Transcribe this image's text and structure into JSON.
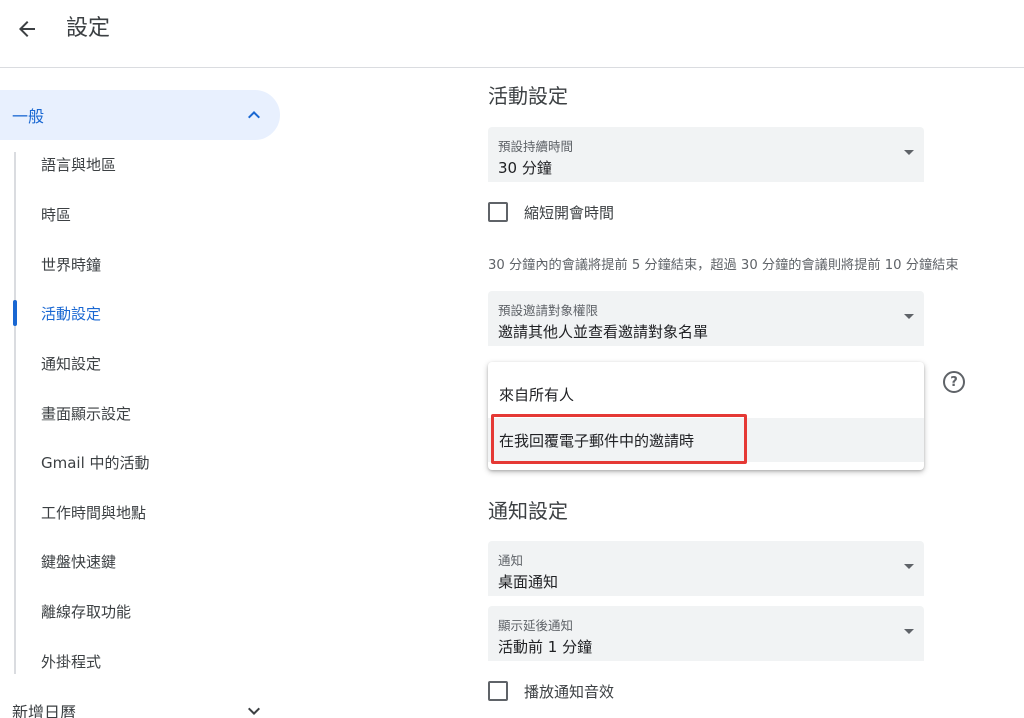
{
  "header": {
    "title": "設定",
    "back_icon": "arrow-back-icon"
  },
  "sidebar": {
    "general": "一般",
    "items": [
      {
        "label": "語言與地區"
      },
      {
        "label": "時區"
      },
      {
        "label": "世界時鐘"
      },
      {
        "label": "活動設定",
        "active": true
      },
      {
        "label": "通知設定"
      },
      {
        "label": "畫面顯示設定"
      },
      {
        "label": "Gmail 中的活動"
      },
      {
        "label": "工作時間與地點"
      },
      {
        "label": "鍵盤快速鍵"
      },
      {
        "label": "離線存取功能"
      },
      {
        "label": "外掛程式"
      }
    ],
    "add_calendar": "新增日曆"
  },
  "event_settings": {
    "title": "活動設定",
    "duration": {
      "label": "預設持續時間",
      "value": "30 分鐘"
    },
    "speedy_meetings": {
      "label": "縮短開會時間",
      "checked": false
    },
    "helper": "30 分鐘內的會議將提前 5 分鐘結束，超過 30 分鐘的會議則將提前 10 分鐘結束",
    "guest_permissions": {
      "label": "預設邀請對象權限",
      "value": "邀請其他人並查看邀請對象名單"
    },
    "dropdown_options": [
      {
        "label": "來自所有人"
      },
      {
        "label": "在我回覆電子郵件中的邀請時",
        "selected": true
      }
    ],
    "help_glyph": "?"
  },
  "notification_settings": {
    "title": "通知設定",
    "notifications": {
      "label": "通知",
      "value": "桌面通知"
    },
    "snoozed": {
      "label": "顯示延後通知",
      "value": "活動前 1 分鐘"
    },
    "play_sounds": {
      "label": "播放通知音效",
      "checked": false
    }
  },
  "colors": {
    "accent": "#1967d2",
    "active_bg": "#e8f0fe",
    "highlight": "#e53935"
  }
}
